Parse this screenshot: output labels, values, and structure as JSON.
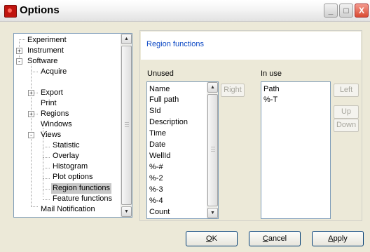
{
  "window": {
    "title": "Options"
  },
  "titlebar_buttons": {
    "minimize": "_",
    "maximize": "□",
    "close": "X"
  },
  "tree": {
    "items": [
      {
        "label": "Experiment",
        "level": 0,
        "expander": ""
      },
      {
        "label": "Instrument",
        "level": 0,
        "expander": "+"
      },
      {
        "label": "Software",
        "level": 0,
        "expander": "-"
      },
      {
        "label": "Acquire",
        "level": 1,
        "expander": ""
      },
      {
        "label": "Export",
        "level": 1,
        "expander": "+"
      },
      {
        "label": "Print",
        "level": 1,
        "expander": ""
      },
      {
        "label": "Regions",
        "level": 1,
        "expander": "+"
      },
      {
        "label": "Windows",
        "level": 1,
        "expander": ""
      },
      {
        "label": "Views",
        "level": 1,
        "expander": "-"
      },
      {
        "label": "Statistic",
        "level": 2,
        "expander": ""
      },
      {
        "label": "Overlay",
        "level": 2,
        "expander": ""
      },
      {
        "label": "Histogram",
        "level": 2,
        "expander": ""
      },
      {
        "label": "Plot options",
        "level": 2,
        "expander": ""
      },
      {
        "label": "Region functions",
        "level": 2,
        "expander": "",
        "selected": true
      },
      {
        "label": "Feature functions",
        "level": 2,
        "expander": ""
      },
      {
        "label": "Mail Notification",
        "level": 1,
        "expander": ""
      }
    ]
  },
  "panel": {
    "title": "Region functions",
    "unused_label": "Unused",
    "in_use_label": "In use",
    "unused_items": [
      "Name",
      "Full path",
      "SId",
      "Description",
      "Time",
      "Date",
      "WellId",
      "%-#",
      "%-2",
      "%-3",
      "%-4",
      "Count"
    ],
    "in_use_items": [
      "Path",
      "%-T"
    ],
    "buttons": {
      "right": "Right",
      "left": "Left",
      "up": "Up",
      "down": "Down"
    }
  },
  "dialog_buttons": {
    "ok": {
      "mnemonic": "O",
      "rest": "K"
    },
    "cancel": {
      "mnemonic": "C",
      "rest": "ancel"
    },
    "apply": {
      "mnemonic": "A",
      "rest": "pply"
    }
  },
  "colors": {
    "panel_title": "#0b48c4",
    "selection": "#c7c7c7",
    "border": "#7f9db9"
  },
  "icons": {
    "app": "app-icon",
    "scroll_up": "scroll-up-icon",
    "scroll_down": "scroll-down-icon"
  }
}
